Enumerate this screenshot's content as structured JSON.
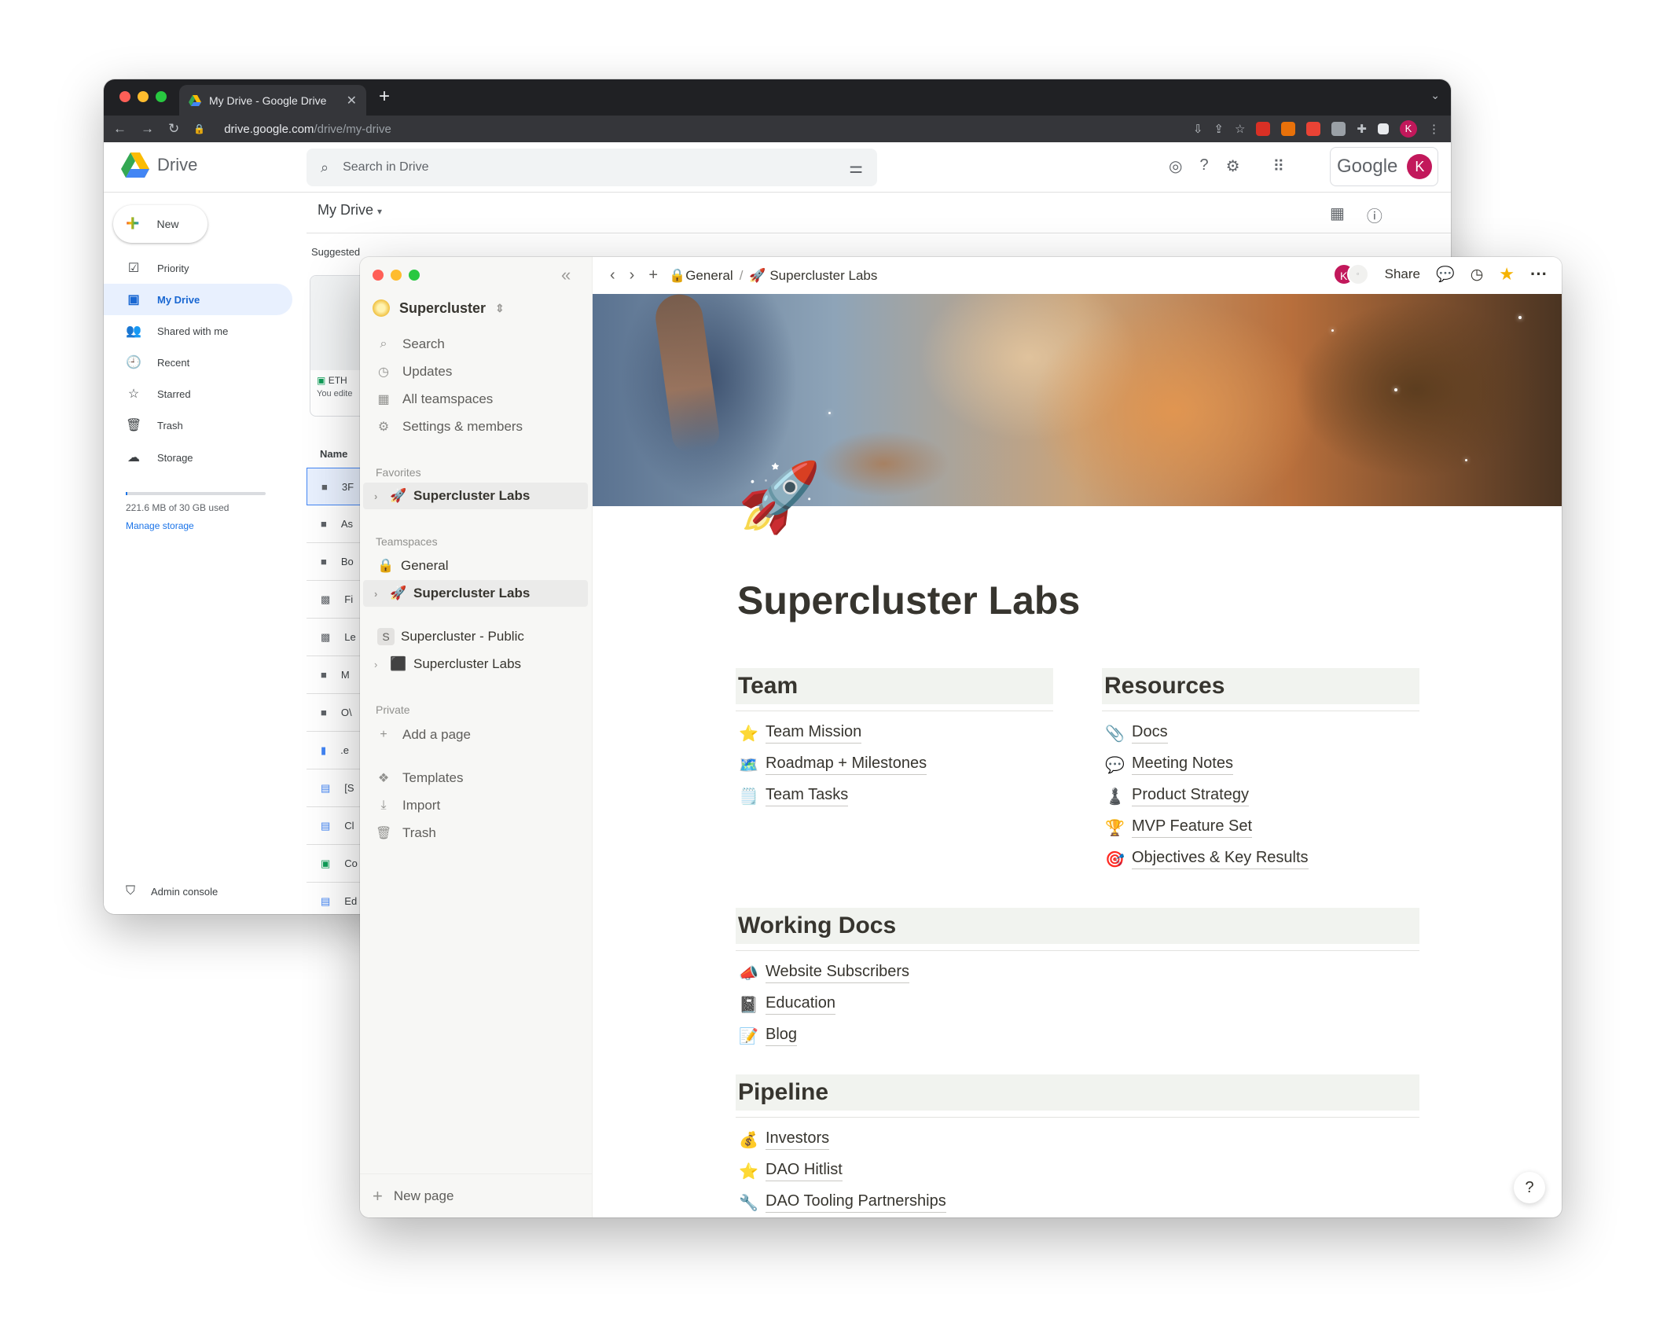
{
  "chrome": {
    "tab_title": "My Drive - Google Drive",
    "tab_close": "✕",
    "new_tab": "+",
    "url_host": "drive.google.com",
    "url_path": "/drive/my-drive"
  },
  "drive": {
    "app_name": "Drive",
    "search_placeholder": "Search in Drive",
    "google_label": "Google",
    "avatar_letter": "K",
    "new_label": "New",
    "nav": [
      {
        "label": "Priority",
        "icon": "☑"
      },
      {
        "label": "My Drive",
        "icon": "▣"
      },
      {
        "label": "Shared with me",
        "icon": "👥"
      },
      {
        "label": "Recent",
        "icon": "🕘"
      },
      {
        "label": "Starred",
        "icon": "☆"
      },
      {
        "label": "Trash",
        "icon": "🗑"
      }
    ],
    "storage_label": "Storage",
    "storage_used": "221.6 MB of 30 GB used",
    "manage_storage": "Manage storage",
    "admin_console": "Admin console",
    "my_drive_title": "My Drive",
    "suggested_label": "Suggested",
    "suggested_card_name": "ETH",
    "suggested_card_sub": "You edite",
    "name_header": "Name",
    "file_rows": [
      "3F",
      "As",
      "Bo",
      "Fi",
      "Le",
      "M",
      "O\\",
      ".e",
      "[S",
      "Cl",
      "Co",
      "Ed"
    ]
  },
  "notion": {
    "workspace": "Supercluster",
    "menu": [
      {
        "label": "Search",
        "icon": "⌕"
      },
      {
        "label": "Updates",
        "icon": "◷"
      },
      {
        "label": "All teamspaces",
        "icon": "▦"
      },
      {
        "label": "Settings & members",
        "icon": "⚙"
      }
    ],
    "favorites_label": "Favorites",
    "favorites": [
      {
        "label": "Supercluster Labs",
        "emoji": "🚀"
      }
    ],
    "teamspaces_label": "Teamspaces",
    "teamspaces": [
      {
        "label": "General",
        "emoji": "🔒"
      },
      {
        "label": "Supercluster Labs",
        "emoji": "🚀"
      },
      {
        "label": "Supercluster - Public",
        "letter": "S"
      },
      {
        "label": "Supercluster Labs",
        "emoji": "⬛"
      }
    ],
    "private_label": "Private",
    "add_page": "Add a page",
    "tools": [
      {
        "label": "Templates",
        "icon": "❖"
      },
      {
        "label": "Import",
        "icon": "⤓"
      },
      {
        "label": "Trash",
        "icon": "🗑"
      }
    ],
    "new_page": "New page",
    "breadcrumb": {
      "first": "General",
      "first_emoji": "🔒",
      "sep": "/",
      "second": "Supercluster Labs",
      "second_emoji": "🚀"
    },
    "share": "Share",
    "avatar_letter": "K",
    "page_icon": "🚀",
    "page_title": "Supercluster Labs",
    "team_heading": "Team",
    "team_links": [
      {
        "emoji": "⭐",
        "label": "Team Mission"
      },
      {
        "emoji": "🗺️",
        "label": "Roadmap + Milestones"
      },
      {
        "emoji": "🗒️",
        "label": "Team Tasks"
      }
    ],
    "resources_heading": "Resources",
    "resources_links": [
      {
        "emoji": "📎",
        "label": "Docs"
      },
      {
        "emoji": "💬",
        "label": "Meeting Notes"
      },
      {
        "emoji": "♟️",
        "label": "Product Strategy"
      },
      {
        "emoji": "🏆",
        "label": "MVP Feature Set"
      },
      {
        "emoji": "🎯",
        "label": "Objectives & Key Results"
      }
    ],
    "working_heading": "Working Docs",
    "working_links": [
      {
        "emoji": "📣",
        "label": "Website Subscribers"
      },
      {
        "emoji": "📓",
        "label": "Education"
      },
      {
        "emoji": "📝",
        "label": "Blog"
      }
    ],
    "pipeline_heading": "Pipeline",
    "pipeline_links": [
      {
        "emoji": "💰",
        "label": "Investors"
      },
      {
        "emoji": "⭐",
        "label": "DAO Hitlist"
      },
      {
        "emoji": "🔧",
        "label": "DAO Tooling Partnerships"
      }
    ],
    "help": "?"
  }
}
